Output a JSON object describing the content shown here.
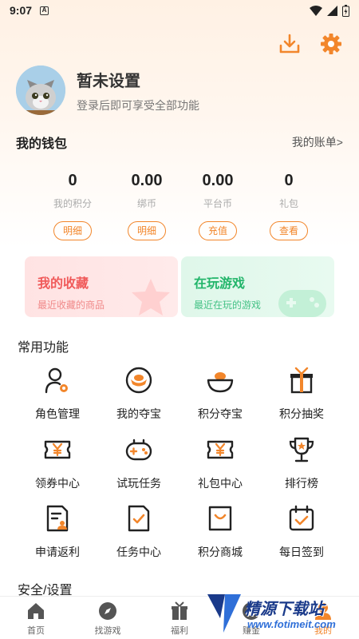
{
  "status_bar": {
    "time": "9:07",
    "app_letter": "A"
  },
  "profile": {
    "name": "暂未设置",
    "subtitle": "登录后即可享受全部功能"
  },
  "wallet": {
    "title": "我的钱包",
    "link": "我的账单>",
    "stats": [
      {
        "value": "0",
        "label": "我的积分",
        "button": "明细"
      },
      {
        "value": "0.00",
        "label": "绑币",
        "button": "明细"
      },
      {
        "value": "0.00",
        "label": "平台币",
        "button": "充值"
      },
      {
        "value": "0",
        "label": "礼包",
        "button": "查看"
      }
    ]
  },
  "promos": [
    {
      "title": "我的收藏",
      "subtitle": "最近收藏的商品",
      "color": "#f05a5a"
    },
    {
      "title": "在玩游戏",
      "subtitle": "最近在玩的游戏",
      "color": "#22b56a"
    }
  ],
  "common": {
    "title": "常用功能",
    "items": [
      {
        "label": "角色管理",
        "icon": "user-gear-icon"
      },
      {
        "label": "我的夺宝",
        "icon": "gold-ingot-icon"
      },
      {
        "label": "积分夺宝",
        "icon": "treasure-bowl-icon"
      },
      {
        "label": "积分抽奖",
        "icon": "gift-box-icon"
      },
      {
        "label": "领券中心",
        "icon": "yen-coupon-icon"
      },
      {
        "label": "试玩任务",
        "icon": "gamepad-icon"
      },
      {
        "label": "礼包中心",
        "icon": "yen-ticket-icon"
      },
      {
        "label": "排行榜",
        "icon": "trophy-icon"
      },
      {
        "label": "申请返利",
        "icon": "document-user-icon"
      },
      {
        "label": "任务中心",
        "icon": "task-check-icon"
      },
      {
        "label": "积分商城",
        "icon": "shopping-bag-icon"
      },
      {
        "label": "每日签到",
        "icon": "calendar-check-icon"
      }
    ]
  },
  "settings": {
    "title": "安全/设置"
  },
  "nav": [
    {
      "label": "首页",
      "icon": "home-icon"
    },
    {
      "label": "找游戏",
      "icon": "compass-icon"
    },
    {
      "label": "福利",
      "icon": "gift-icon"
    },
    {
      "label": "赚金",
      "icon": "coin-icon"
    },
    {
      "label": "我的",
      "icon": "profile-icon"
    }
  ],
  "watermark": {
    "text": "精源下载站",
    "url": "www.fotimeit.com"
  },
  "colors": {
    "accent": "#f2862b",
    "fav": "#f05a5a",
    "play": "#22b56a"
  }
}
